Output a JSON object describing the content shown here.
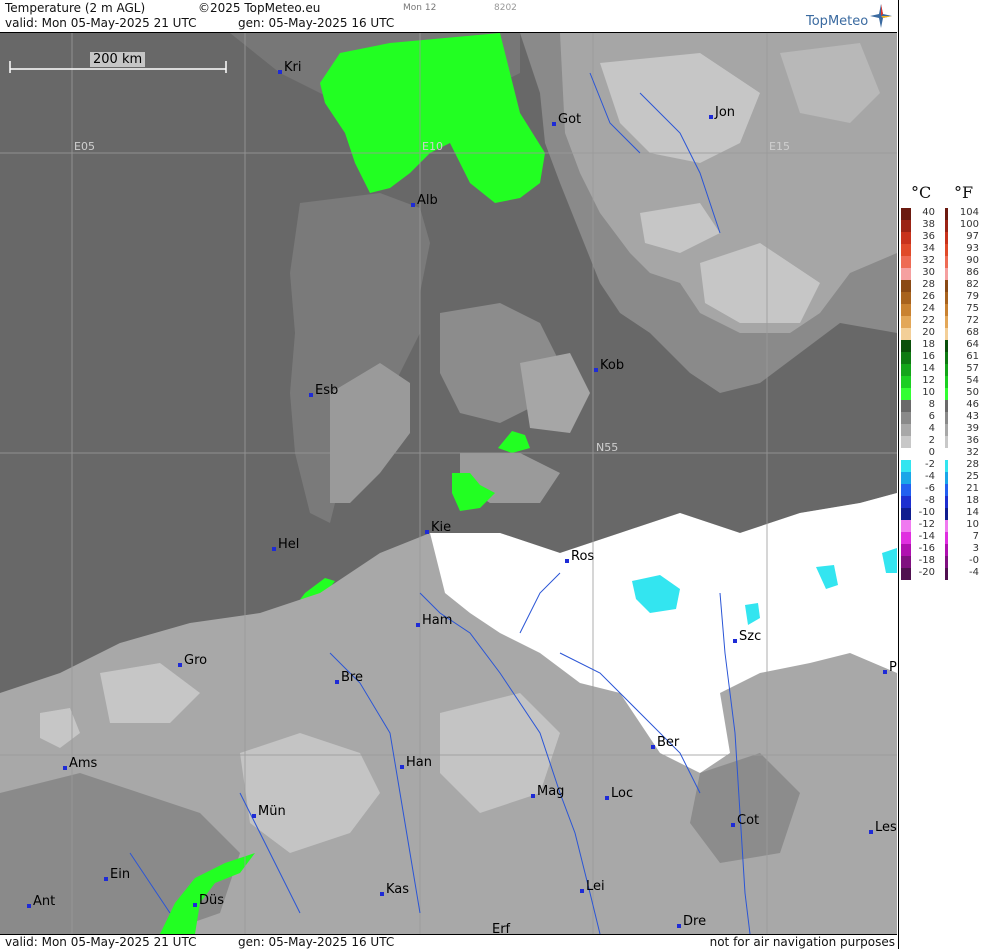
{
  "header": {
    "title": "Temperature (2 m AGL)",
    "copyright": "©2025 TopMeteo.eu",
    "valid": "valid:  Mon  05-May-2025  21 UTC",
    "gen": "gen: 05-May-2025 16 UTC",
    "tab": "Mon 12",
    "code": "8202",
    "brand": "TopMeteo"
  },
  "footer": {
    "valid": "valid:  Mon  05-May-2025  21 UTC",
    "gen": "gen: 05-May-2025 16 UTC",
    "disclaimer": "not for air navigation purposes"
  },
  "scale_bar": {
    "label": "200 km"
  },
  "grid_labels": [
    "E05",
    "E10",
    "E15",
    "N55"
  ],
  "cities": [
    {
      "name": "Kri"
    },
    {
      "name": "Got"
    },
    {
      "name": "Jon"
    },
    {
      "name": "Alb"
    },
    {
      "name": "Esb"
    },
    {
      "name": "Kob"
    },
    {
      "name": "Kie"
    },
    {
      "name": "Hel"
    },
    {
      "name": "Ros"
    },
    {
      "name": "Ham"
    },
    {
      "name": "Szc"
    },
    {
      "name": "Gro"
    },
    {
      "name": "Bre"
    },
    {
      "name": "P"
    },
    {
      "name": "Ber"
    },
    {
      "name": "Ams"
    },
    {
      "name": "Han"
    },
    {
      "name": "Mag"
    },
    {
      "name": "Loc"
    },
    {
      "name": "Mün"
    },
    {
      "name": "Cot"
    },
    {
      "name": "Les"
    },
    {
      "name": "Ein"
    },
    {
      "name": "Lei"
    },
    {
      "name": "Kas"
    },
    {
      "name": "Ant"
    },
    {
      "name": "Düs"
    },
    {
      "name": "Dre"
    },
    {
      "name": "Erf"
    }
  ],
  "legend": {
    "unit_c": "°C",
    "unit_f": "°F",
    "rows": [
      {
        "c": "40",
        "f": "104",
        "color": "#6b1a10"
      },
      {
        "c": "38",
        "f": "100",
        "color": "#9b2315"
      },
      {
        "c": "36",
        "f": "97",
        "color": "#c8321c"
      },
      {
        "c": "34",
        "f": "93",
        "color": "#e04a2a"
      },
      {
        "c": "32",
        "f": "90",
        "color": "#ee6b55"
      },
      {
        "c": "30",
        "f": "86",
        "color": "#f5a0a0"
      },
      {
        "c": "28",
        "f": "82",
        "color": "#8a4a15"
      },
      {
        "c": "26",
        "f": "79",
        "color": "#a8631e"
      },
      {
        "c": "24",
        "f": "75",
        "color": "#c98231"
      },
      {
        "c": "22",
        "f": "72",
        "color": "#e3a758"
      },
      {
        "c": "20",
        "f": "68",
        "color": "#f3cf98"
      },
      {
        "c": "18",
        "f": "64",
        "color": "#0a4f0a"
      },
      {
        "c": "16",
        "f": "61",
        "color": "#0e7a12"
      },
      {
        "c": "14",
        "f": "57",
        "color": "#14a51a"
      },
      {
        "c": "12",
        "f": "54",
        "color": "#1ccf22"
      },
      {
        "c": "10",
        "f": "50",
        "color": "#33ff33"
      },
      {
        "c": "8",
        "f": "46",
        "color": "#6a6a6a"
      },
      {
        "c": "6",
        "f": "43",
        "color": "#8a8a8a"
      },
      {
        "c": "4",
        "f": "39",
        "color": "#a8a8a8"
      },
      {
        "c": "2",
        "f": "36",
        "color": "#c8c8c8"
      },
      {
        "c": "0",
        "f": "32",
        "color": "#ffffff"
      },
      {
        "c": "-2",
        "f": "28",
        "color": "#33e5f0"
      },
      {
        "c": "-4",
        "f": "25",
        "color": "#1aa6e8"
      },
      {
        "c": "-6",
        "f": "21",
        "color": "#2360f0"
      },
      {
        "c": "-8",
        "f": "18",
        "color": "#1e2fd0"
      },
      {
        "c": "-10",
        "f": "14",
        "color": "#101c8f"
      },
      {
        "c": "-12",
        "f": "10",
        "color": "#f07af0"
      },
      {
        "c": "-14",
        "f": "7",
        "color": "#e02ee0"
      },
      {
        "c": "-16",
        "f": "3",
        "color": "#b010b0"
      },
      {
        "c": "-18",
        "f": "-0",
        "color": "#801080"
      },
      {
        "c": "-20",
        "f": "-4",
        "color": "#501050"
      }
    ]
  },
  "colors": {
    "sea_gray": "#6a6a6a",
    "land_light": "#a8a8a8",
    "warm_green": "#22ff22",
    "freezing_cyan": "#33e5f0",
    "city_marker": "#1e2bd6",
    "river": "#2a55d6"
  }
}
